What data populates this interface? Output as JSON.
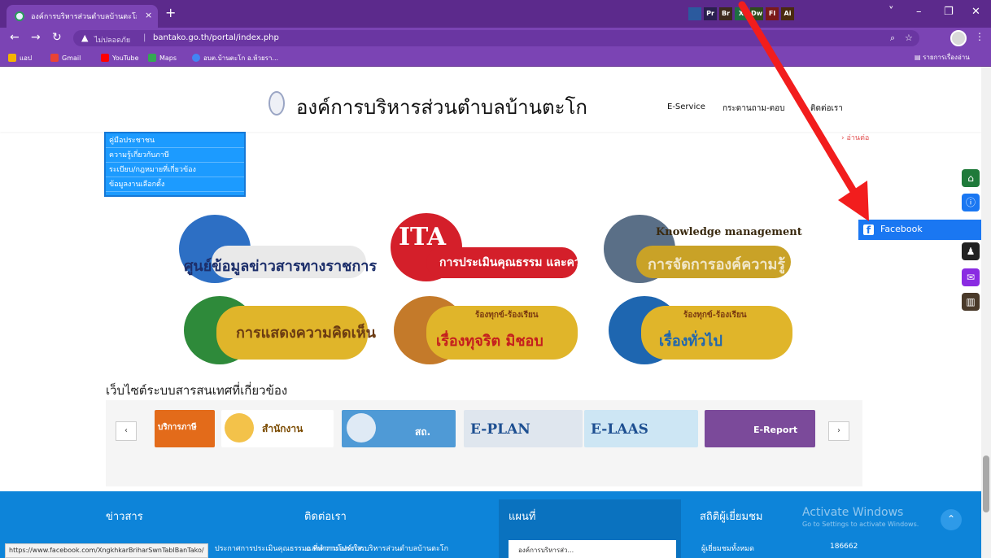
{
  "browser": {
    "tab_title": "องค์การบริหารส่วนตำบลบ้านตะโก",
    "tab_close": "×",
    "new_tab": "+",
    "secure_label": "ไม่ปลอดภัย",
    "url": "bantako.go.th/portal/index.php",
    "window_controls": [
      "˅",
      "–",
      "❐",
      "✕"
    ],
    "bookmarks": [
      {
        "label": "แอป",
        "color": "#f4b400"
      },
      {
        "label": "Gmail",
        "color": "#ea4335"
      },
      {
        "label": "YouTube",
        "color": "#ff0000"
      },
      {
        "label": "Maps",
        "color": "#34a853"
      },
      {
        "label": "อบต.บ้านตะโก อ.ห้วยรา...",
        "color": "#4285f4"
      }
    ],
    "reading_list": "รายการเรื่องอ่าน",
    "taskbar_icons": [
      {
        "label": "",
        "color": "#2b5a9e"
      },
      {
        "label": "Pr",
        "color": "#2a1f4f"
      },
      {
        "label": "Br",
        "color": "#3d2a1d"
      },
      {
        "label": "X",
        "color": "#1e6e42"
      },
      {
        "label": "Dw",
        "color": "#2f4b1d"
      },
      {
        "label": "Fl",
        "color": "#7a1a1a"
      },
      {
        "label": "Ai",
        "color": "#4a2a0f"
      }
    ]
  },
  "header": {
    "site_title": "องค์การบริหารส่วนตำบลบ้านตะโก",
    "nav": [
      "E-Service",
      "กระดานถาม-ตอบ",
      "ติดต่อเรา"
    ]
  },
  "left_menu": {
    "items": [
      "คู่มือประชาชน",
      "ความรู้เกี่ยวกับภาษี",
      "ระเบียบ/กฎหมายที่เกี่ยวข้อง",
      "ข้อมูลงานเลือกตั้ง"
    ]
  },
  "more_link": "อ่านต่อ",
  "facebook_tab": "Facebook",
  "banners": [
    {
      "title": "ศูนย์ข้อมูลข่าวสารทางราชการ",
      "kicker": "",
      "colors": [
        "#2d6fc4",
        "#c9a227"
      ]
    },
    {
      "title": "การประเมินคุณธรรม และความโปร่งใส",
      "kicker": "ITA",
      "colors": [
        "#d41f2a",
        "#c9a227"
      ]
    },
    {
      "title": "การจัดการองค์ความรู้",
      "kicker": "Knowledge management",
      "colors": [
        "#5a6f87",
        "#c9a227"
      ]
    },
    {
      "title": "การแสดงความคิดเห็น",
      "kicker": "",
      "colors": [
        "#2e8a3a",
        "#e0b52a"
      ]
    },
    {
      "title": "เรื่องทุจริต มิชอบ",
      "kicker": "ร้องทุกข์-ร้องเรียน",
      "colors": [
        "#c47a2a",
        "#e0b52a"
      ]
    },
    {
      "title": "เรื่องทั่วไป",
      "kicker": "ร้องทุกข์-ร้องเรียน",
      "colors": [
        "#1e66b0",
        "#e0b52a"
      ]
    }
  ],
  "related": {
    "title": "เว็บไซต์ระบบสารสนเทศที่เกี่ยวข้อง",
    "items": [
      {
        "label": "บริการภาษี",
        "bg": "#e36b1a",
        "fg": "#ffffff"
      },
      {
        "label": "สำนักงาน",
        "bg": "#f3c24a",
        "fg": "#7a4a00"
      },
      {
        "label": "สถ.",
        "bg": "#4f9ad6",
        "fg": "#ffffff"
      },
      {
        "label": "E-PLAN",
        "bg": "#dfe6ee",
        "fg": "#1d4f91"
      },
      {
        "label": "E-LAAS",
        "bg": "#cde6f4",
        "fg": "#1d4f91"
      },
      {
        "label": "E-Report",
        "bg": "#7b4a9a",
        "fg": "#ffffff"
      }
    ],
    "prev": "‹",
    "next": "›"
  },
  "footer": {
    "cols": [
      {
        "title": "ข่าวสาร",
        "line": "ประกาศการประเมินคุณธรรมและความโปร่งใส..."
      },
      {
        "title": "ติดต่อเรา",
        "line": "ที่ทำการองค์การบริหารส่วนตำบลบ้านตะโก"
      },
      {
        "title": "แผนที่",
        "line": "องค์การบริหารส่ว..."
      },
      {
        "title": "สถิติผู้เยี่ยมชม",
        "line": "ผู้เยี่ยมชมทั้งหมด"
      }
    ],
    "visitor_count": "186662"
  },
  "activate": {
    "title": "Activate Windows",
    "subtitle": "Go to Settings to activate Windows."
  },
  "status_url": "https://www.facebook.com/XngkhkarBriharSwnTablBanTako/"
}
